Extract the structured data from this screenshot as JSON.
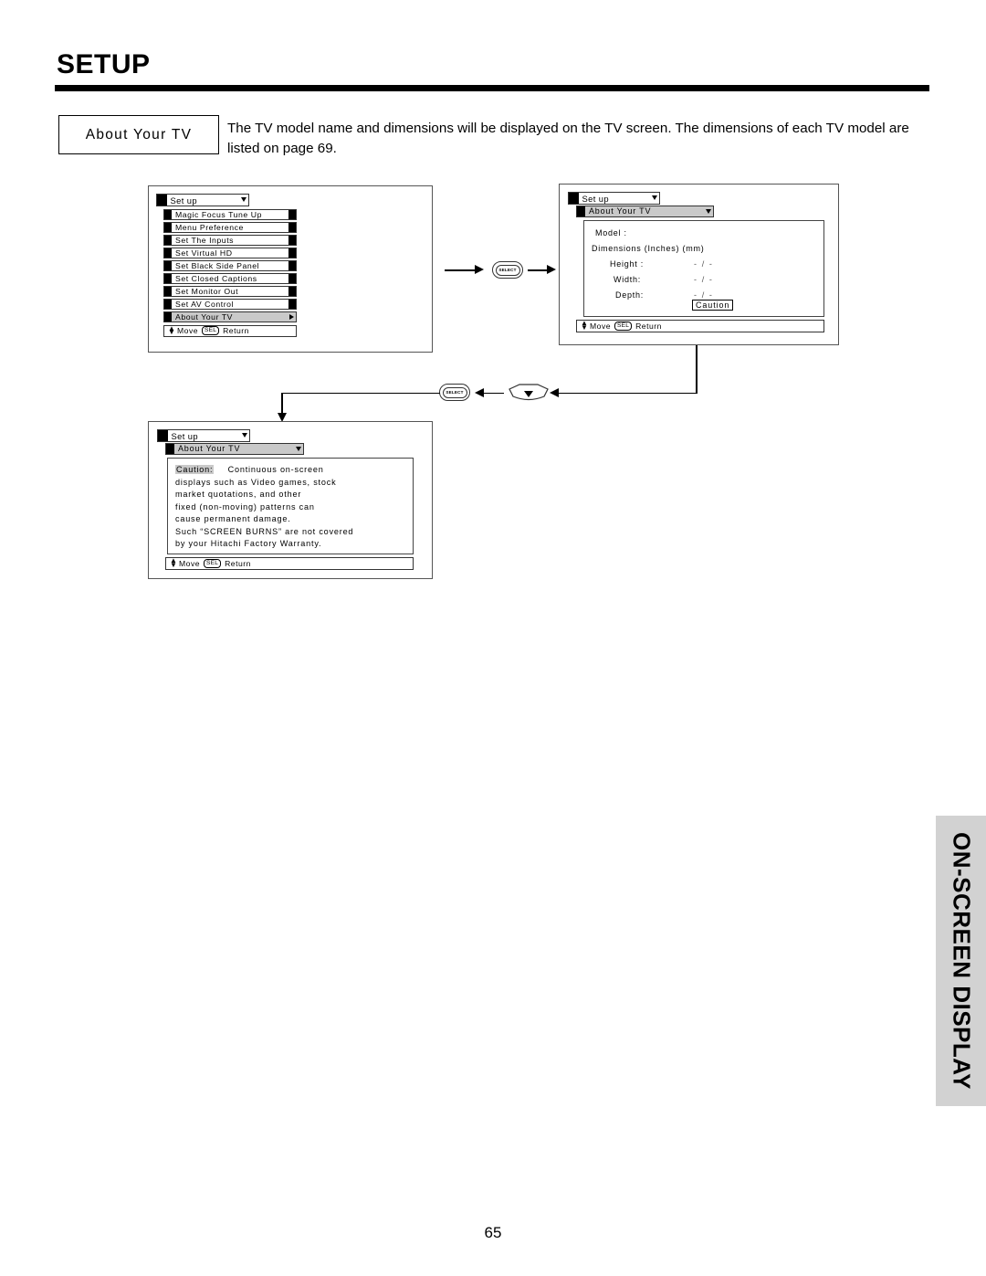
{
  "page": {
    "title": "SETUP",
    "number": "65",
    "side_tab_label": "ON-SCREEN DISPLAY"
  },
  "intro": {
    "chip_label": "About  Your  TV",
    "paragraph": "The TV model name and dimensions will be displayed on the TV screen.  The dimensions of each TV model are listed on page 69."
  },
  "osd": {
    "menu_title": "Set up",
    "hint": {
      "move": "Move",
      "sel_key": "SEL",
      "return": "Return"
    },
    "screen1": {
      "items": [
        "Magic  Focus  Tune  Up",
        "Menu  Preference",
        "Set  The  Inputs",
        "Set  Virtual  HD",
        "Set  Black  Side  Panel",
        "Set  Closed  Captions",
        "Set  Monitor  Out",
        "Set  AV  Control"
      ],
      "selected_item": "About  Your  TV"
    },
    "screen2": {
      "subbar": "About  Your  TV",
      "model_label": "Model :",
      "dimensions_label": "Dimensions   (Inches)  (mm)",
      "rows": [
        {
          "label": "Height :",
          "value": "-  /  -"
        },
        {
          "label": "Width:",
          "value": "-  /  -"
        },
        {
          "label": "Depth:",
          "value": "-  /  -"
        }
      ],
      "caution_button": "Caution"
    },
    "screen3": {
      "subbar": "About  Your  TV",
      "caution_heading": "Caution:",
      "caution_lines": [
        "Continuous  on-screen",
        "displays such as Video games, stock",
        "market   quotations,   and   other",
        "fixed (non-moving) patterns can",
        "cause permanent  damage.",
        "Such “SCREEN BURNS” are not covered",
        "by your Hitachi Factory Warranty."
      ]
    }
  },
  "controls": {
    "select_label": "SELECT",
    "down_key_name": "down-arrow-key"
  }
}
